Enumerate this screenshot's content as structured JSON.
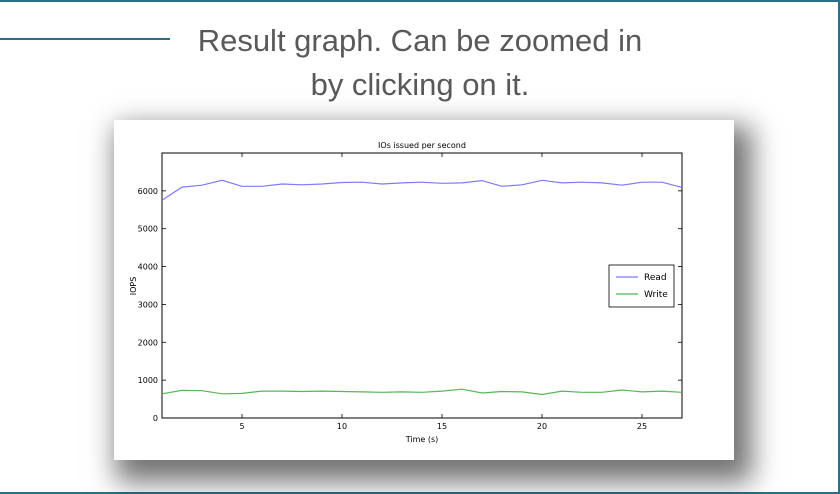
{
  "caption": {
    "line1": "Result graph. Can be zoomed in",
    "line2": "by clicking on it."
  },
  "colors": {
    "frame": "#2b6f88",
    "read": "#7b7bff",
    "write": "#55b855"
  },
  "chart_data": {
    "type": "line",
    "title": "IOs issued per second",
    "xlabel": "Time (s)",
    "ylabel": "IOPS",
    "xlim": [
      1,
      27
    ],
    "ylim": [
      0,
      7000
    ],
    "xticks": [
      5,
      10,
      15,
      20,
      25
    ],
    "yticks": [
      0,
      1000,
      2000,
      3000,
      4000,
      5000,
      6000
    ],
    "legend_position": "right",
    "grid": false,
    "x": [
      1,
      2,
      3,
      4,
      5,
      6,
      7,
      8,
      9,
      10,
      11,
      12,
      13,
      14,
      15,
      16,
      17,
      18,
      19,
      20,
      21,
      22,
      23,
      24,
      25,
      26,
      27
    ],
    "series": [
      {
        "name": "Read",
        "color": "#7b7bff",
        "values": [
          5750,
          6100,
          6150,
          6280,
          6120,
          6120,
          6180,
          6160,
          6180,
          6220,
          6230,
          6180,
          6210,
          6230,
          6200,
          6210,
          6270,
          6120,
          6160,
          6280,
          6210,
          6230,
          6210,
          6150,
          6230,
          6230,
          6090
        ]
      },
      {
        "name": "Write",
        "color": "#55b855",
        "values": [
          640,
          730,
          720,
          640,
          650,
          710,
          710,
          700,
          710,
          700,
          690,
          680,
          690,
          680,
          710,
          760,
          660,
          700,
          690,
          620,
          710,
          680,
          680,
          740,
          690,
          710,
          680
        ]
      }
    ]
  }
}
